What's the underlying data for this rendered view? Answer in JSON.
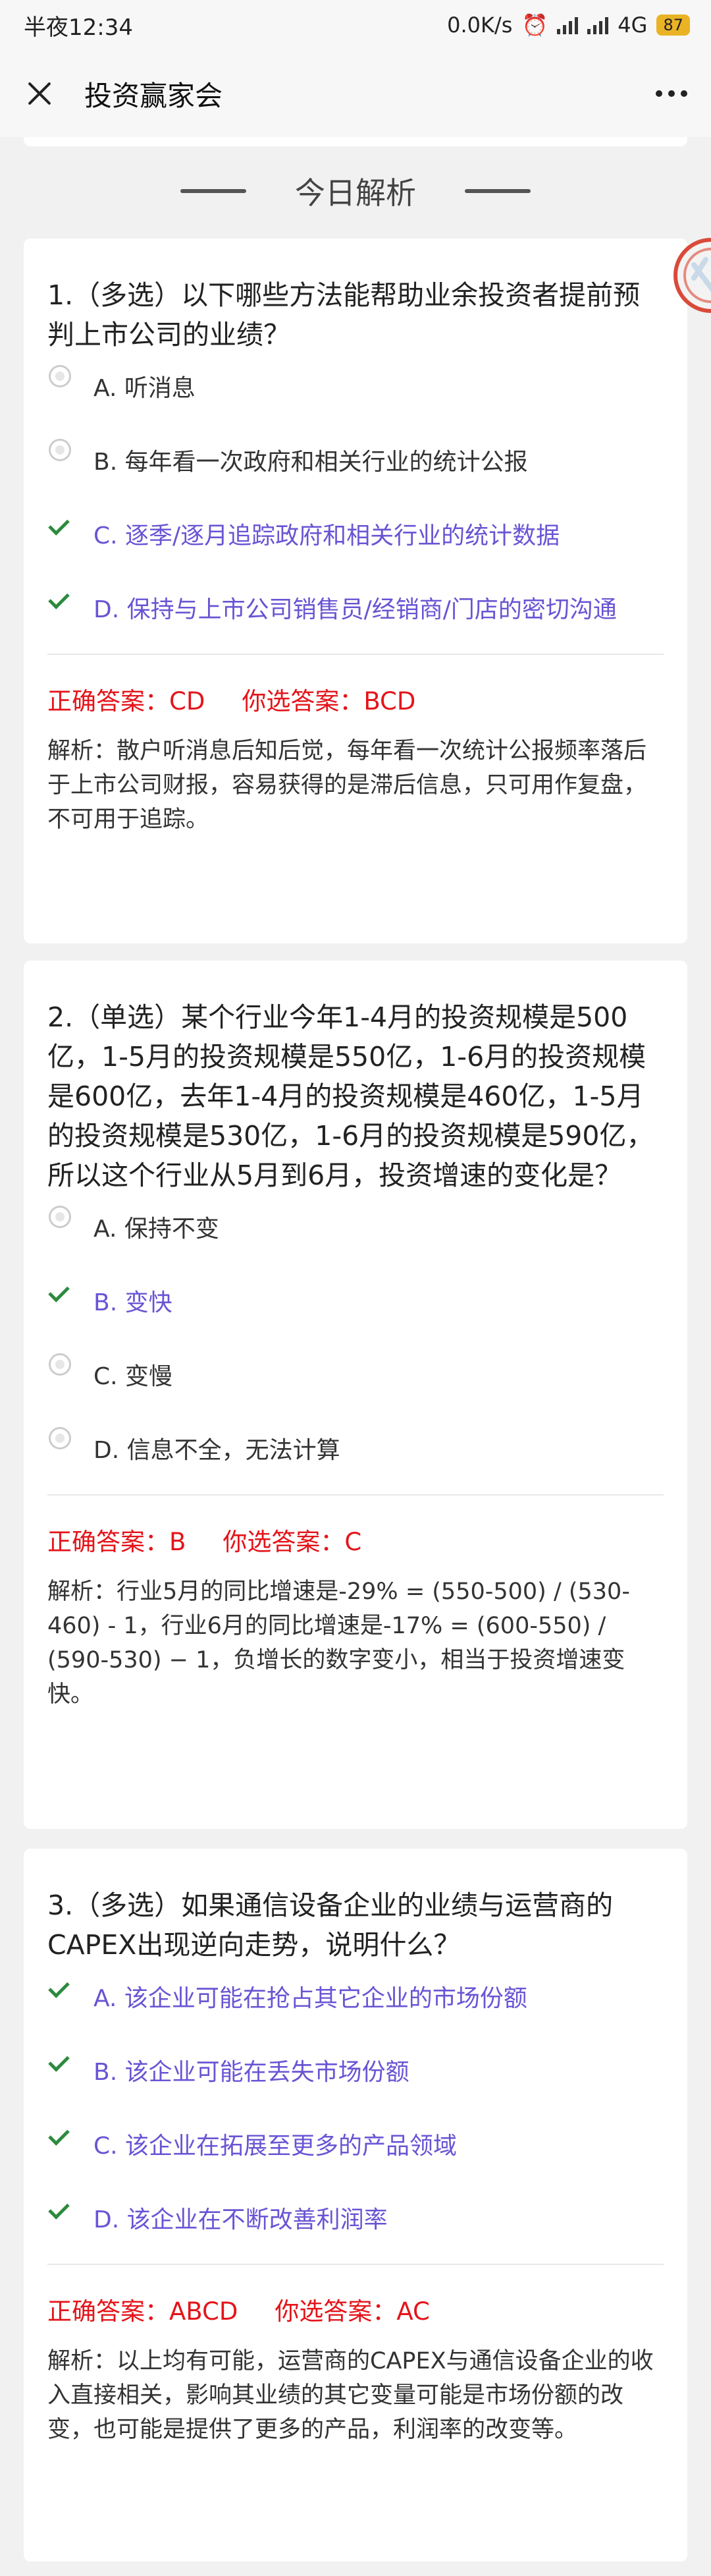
{
  "status_bar": {
    "time": "半夜12:34",
    "speed": "0.0K/s",
    "network": "4G",
    "battery": "87"
  },
  "nav": {
    "title": "投资赢家会"
  },
  "section": {
    "title": "今日解析"
  },
  "questions": [
    {
      "title": "1.（多选）以下哪些方法能帮助业余投资者提前预判上市公司的业绩？",
      "options": [
        {
          "label": "A. 听消息",
          "state": "radio"
        },
        {
          "label": "B. 每年看一次政府和相关行业的统计公报",
          "state": "radio"
        },
        {
          "label": "C. 逐季/逐月追踪政府和相关行业的统计数据",
          "state": "check"
        },
        {
          "label": "D. 保持与上市公司销售员/经销商/门店的密切沟通",
          "state": "check"
        }
      ],
      "correct": "正确答案：CD",
      "chosen": "你选答案：BCD",
      "analysis": "解析：散户听消息后知后觉，每年看一次统计公报频率落后于上市公司财报，容易获得的是滞后信息，只可用作复盘，不可用于追踪。"
    },
    {
      "title": "2.（单选）某个行业今年1-4月的投资规模是500亿，1-5月的投资规模是550亿，1-6月的投资规模是600亿，去年1-4月的投资规模是460亿，1-5月的投资规模是530亿，1-6月的投资规模是590亿，所以这个行业从5月到6月，投资增速的变化是？",
      "options": [
        {
          "label": "A. 保持不变",
          "state": "radio"
        },
        {
          "label": "B. 变快",
          "state": "check"
        },
        {
          "label": "C. 变慢",
          "state": "radio"
        },
        {
          "label": "D. 信息不全，无法计算",
          "state": "radio"
        }
      ],
      "correct": "正确答案：B",
      "chosen": "你选答案：C",
      "analysis": "解析：行业5月的同比增速是-29% = (550-500) / (530-460) - 1，行业6月的同比增速是-17% = (600-550) / (590-530) − 1，负增长的数字变小，相当于投资增速变快。"
    },
    {
      "title": "3.（多选）如果通信设备企业的业绩与运营商的CAPEX出现逆向走势，说明什么？",
      "options": [
        {
          "label": "A. 该企业可能在抢占其它企业的市场份额",
          "state": "check"
        },
        {
          "label": "B. 该企业可能在丢失市场份额",
          "state": "check"
        },
        {
          "label": "C. 该企业在拓展至更多的产品领域",
          "state": "check"
        },
        {
          "label": "D. 该企业在不断改善利润率",
          "state": "check"
        }
      ],
      "correct": "正确答案：ABCD",
      "chosen": "你选答案：AC",
      "analysis": "解析：以上均有可能，运营商的CAPEX与通信设备企业的收入直接相关，影响其业绩的其它变量可能是市场份额的改变，也可能是提供了更多的产品，利润率的改变等。"
    }
  ]
}
